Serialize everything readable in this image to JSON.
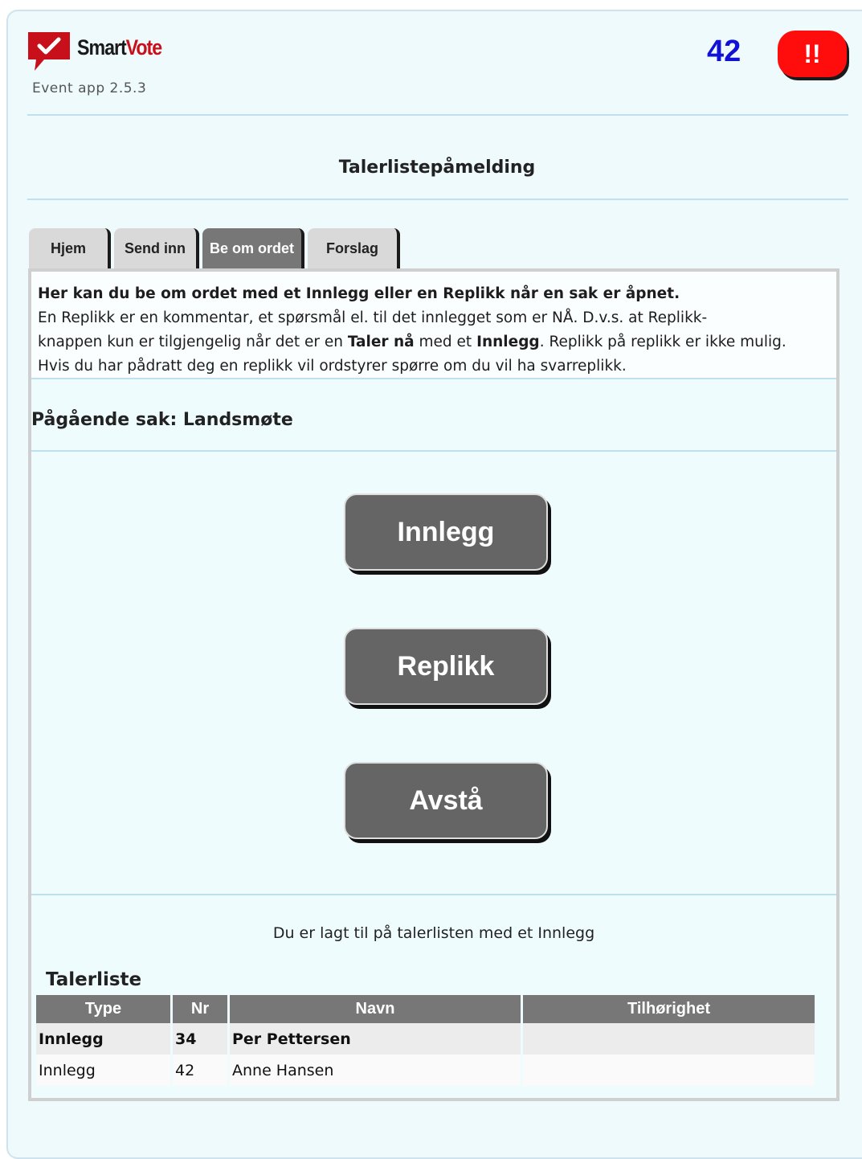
{
  "header": {
    "brand_part1": "Smart",
    "brand_part2": "Vote",
    "version": "Event app 2.5.3",
    "counter": "42",
    "alert_label": "!!"
  },
  "page_title": "Talerlistepåmelding",
  "tabs": [
    {
      "label": "Hjem"
    },
    {
      "label": "Send inn"
    },
    {
      "label": "Be om ordet",
      "active": true
    },
    {
      "label": "Forslag"
    }
  ],
  "info": {
    "line1": "Her kan du be om ordet med et Innlegg eller en Replikk når en sak er åpnet.",
    "line2_pre": "En Replikk er en kommentar, et spørsmål el. til det innlegget som er NÅ. D.v.s. at Replikk-",
    "line3_a": "knappen kun er tilgjengelig når det er en ",
    "line3_b": "Taler nå",
    "line3_c": " med et ",
    "line3_d": "Innlegg",
    "line3_e": ". Replikk på replikk er ikke mulig.",
    "line4": "Hvis du har pådratt deg en replikk vil ordstyrer spørre om du vil ha svarreplikk."
  },
  "current_item": "Pågående sak: Landsmøte",
  "buttons": {
    "innlegg": "Innlegg",
    "replikk": "Replikk",
    "avsta": "Avstå"
  },
  "status_message": "Du er lagt til på talerlisten med et Innlegg",
  "talerliste": {
    "title": "Talerliste",
    "columns": [
      "Type",
      "Nr",
      "Navn",
      "Tilhørighet"
    ],
    "rows": [
      {
        "type": "Innlegg",
        "nr": "34",
        "navn": "Per Pettersen",
        "tilhorighet": ""
      },
      {
        "type": "Innlegg",
        "nr": "42",
        "navn": "Anne Hansen",
        "tilhorighet": ""
      }
    ]
  },
  "colors": {
    "brand_red": "#c8101a",
    "alert_red": "#ff0d0d",
    "counter_blue": "#1212d6",
    "button_gray": "#656565",
    "panel_bg": "#effcfd"
  }
}
